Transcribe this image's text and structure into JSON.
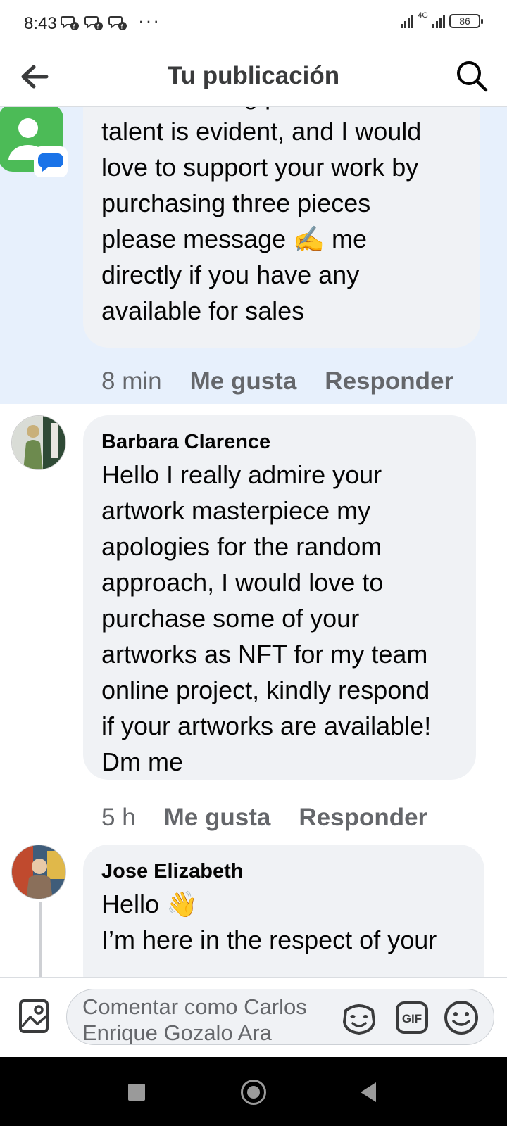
{
  "status_bar": {
    "time": "8:43",
    "more": "···",
    "network": "4G",
    "battery": "86"
  },
  "header": {
    "title": "Tu publicación"
  },
  "comments": [
    {
      "author": "",
      "text": "such stunning pieces. Your\ntalent is evident, and I would\nlove to support your work by\npurchasing three pieces\nplease message ✍️ me\ndirectly if you have any\navailable for sales",
      "time": "8 min",
      "like_label": "Me gusta",
      "reply_label": "Responder",
      "highlighted": true
    },
    {
      "author": "Barbara Clarence",
      "text": "Hello I really admire your\nartwork masterpiece my\napologies for the random\napproach, I would love to\npurchase some of your\nartworks as NFT for my team\nonline project, kindly respond\nif your artworks are available!\nDm me",
      "time": "5 h",
      "like_label": "Me gusta",
      "reply_label": "Responder"
    },
    {
      "author": "Jose Elizabeth",
      "text": "Hello 👋\nI’m here in the respect of your",
      "time": "",
      "like_label": "",
      "reply_label": ""
    }
  ],
  "composer": {
    "placeholder": "Comentar como Carlos Enrique Gozalo Ara",
    "gif_label": "GIF"
  },
  "colors": {
    "highlight": "#e7f0fc",
    "bubble": "#f0f2f5",
    "secondary_text": "#65676b",
    "messages_green": "#4cbb57",
    "messages_blue": "#1a73e8"
  }
}
